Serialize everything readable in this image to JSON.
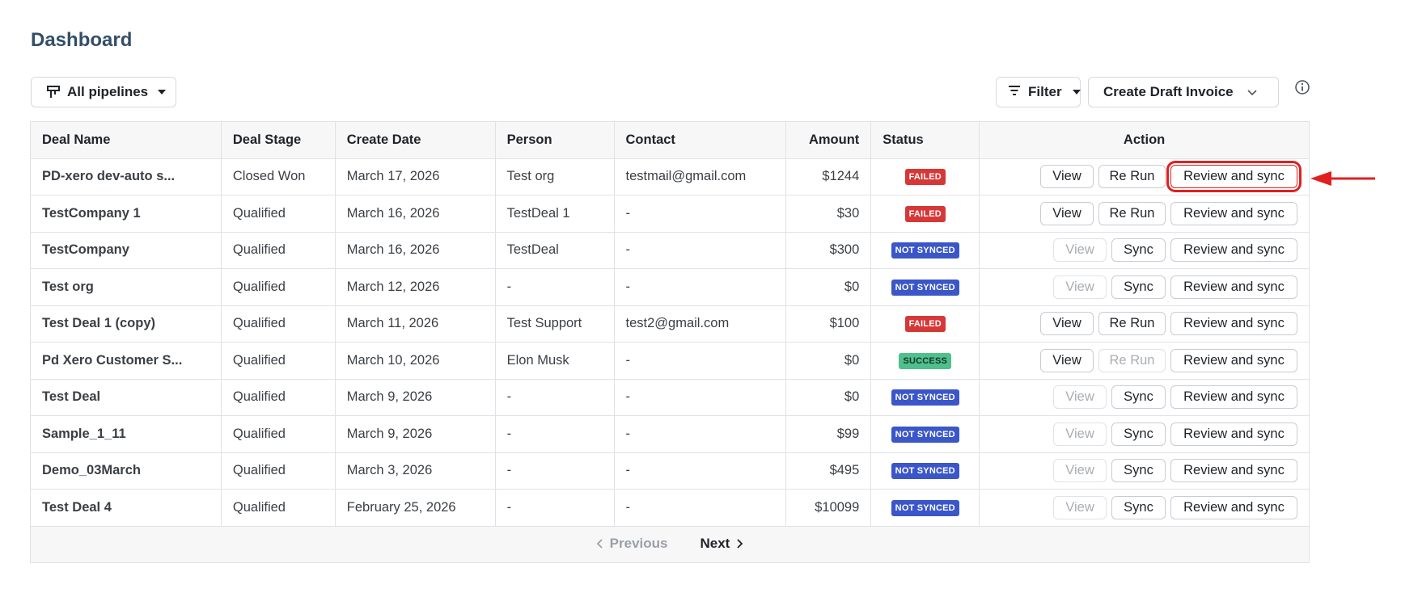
{
  "header": {
    "title": "Dashboard"
  },
  "toolbar": {
    "pipelines_label": "All pipelines",
    "filter_label": "Filter",
    "draft_invoice_label": "Create Draft Invoice"
  },
  "table": {
    "columns": [
      "Deal Name",
      "Deal Stage",
      "Create Date",
      "Person",
      "Contact",
      "Amount",
      "Status",
      "Action"
    ],
    "rows": [
      {
        "deal_name": "PD-xero dev-auto s...",
        "stage": "Closed Won",
        "date": "March 17, 2026",
        "person": "Test org",
        "contact": "testmail@gmail.com",
        "amount": "$1244",
        "status": "FAILED",
        "status_kind": "failed",
        "view": "View",
        "view_disabled": false,
        "second": "Re Run",
        "second_disabled": false,
        "review": "Review and sync"
      },
      {
        "deal_name": "TestCompany 1",
        "stage": "Qualified",
        "date": "March 16, 2026",
        "person": "TestDeal 1",
        "contact": "-",
        "amount": "$30",
        "status": "FAILED",
        "status_kind": "failed",
        "view": "View",
        "view_disabled": false,
        "second": "Re Run",
        "second_disabled": false,
        "review": "Review and sync"
      },
      {
        "deal_name": "TestCompany",
        "stage": "Qualified",
        "date": "March 16, 2026",
        "person": "TestDeal",
        "contact": "-",
        "amount": "$300",
        "status": "NOT SYNCED",
        "status_kind": "not-synced",
        "view": "View",
        "view_disabled": true,
        "second": "Sync",
        "second_disabled": false,
        "review": "Review and sync"
      },
      {
        "deal_name": "Test org",
        "stage": "Qualified",
        "date": "March 12, 2026",
        "person": "-",
        "contact": "-",
        "amount": "$0",
        "status": "NOT SYNCED",
        "status_kind": "not-synced",
        "view": "View",
        "view_disabled": true,
        "second": "Sync",
        "second_disabled": false,
        "review": "Review and sync"
      },
      {
        "deal_name": "Test Deal 1 (copy)",
        "stage": "Qualified",
        "date": "March 11, 2026",
        "person": "Test Support",
        "contact": "test2@gmail.com",
        "amount": "$100",
        "status": "FAILED",
        "status_kind": "failed",
        "view": "View",
        "view_disabled": false,
        "second": "Re Run",
        "second_disabled": false,
        "review": "Review and sync"
      },
      {
        "deal_name": "Pd Xero Customer S...",
        "stage": "Qualified",
        "date": "March 10, 2026",
        "person": "Elon Musk",
        "contact": "-",
        "amount": "$0",
        "status": "SUCCESS",
        "status_kind": "success",
        "view": "View",
        "view_disabled": false,
        "second": "Re Run",
        "second_disabled": true,
        "review": "Review and sync"
      },
      {
        "deal_name": "Test Deal",
        "stage": "Qualified",
        "date": "March 9, 2026",
        "person": "-",
        "contact": "-",
        "amount": "$0",
        "status": "NOT SYNCED",
        "status_kind": "not-synced",
        "view": "View",
        "view_disabled": true,
        "second": "Sync",
        "second_disabled": false,
        "review": "Review and sync"
      },
      {
        "deal_name": "Sample_1_11",
        "stage": "Qualified",
        "date": "March 9, 2026",
        "person": "-",
        "contact": "-",
        "amount": "$99",
        "status": "NOT SYNCED",
        "status_kind": "not-synced",
        "view": "View",
        "view_disabled": true,
        "second": "Sync",
        "second_disabled": false,
        "review": "Review and sync"
      },
      {
        "deal_name": "Demo_03March",
        "stage": "Qualified",
        "date": "March 3, 2026",
        "person": "-",
        "contact": "-",
        "amount": "$495",
        "status": "NOT SYNCED",
        "status_kind": "not-synced",
        "view": "View",
        "view_disabled": true,
        "second": "Sync",
        "second_disabled": false,
        "review": "Review and sync"
      },
      {
        "deal_name": "Test Deal 4",
        "stage": "Qualified",
        "date": "February 25, 2026",
        "person": "-",
        "contact": "-",
        "amount": "$10099",
        "status": "NOT SYNCED",
        "status_kind": "not-synced",
        "view": "View",
        "view_disabled": true,
        "second": "Sync",
        "second_disabled": false,
        "review": "Review and sync"
      }
    ]
  },
  "pagination": {
    "previous_label": "Previous",
    "next_label": "Next"
  },
  "annotation": {
    "highlighted_row": 0,
    "highlight_color": "#e02020"
  },
  "colors": {
    "title": "#334e68",
    "failed": "#d63838",
    "not_synced": "#3b56c9",
    "success": "#4fbf8c"
  }
}
